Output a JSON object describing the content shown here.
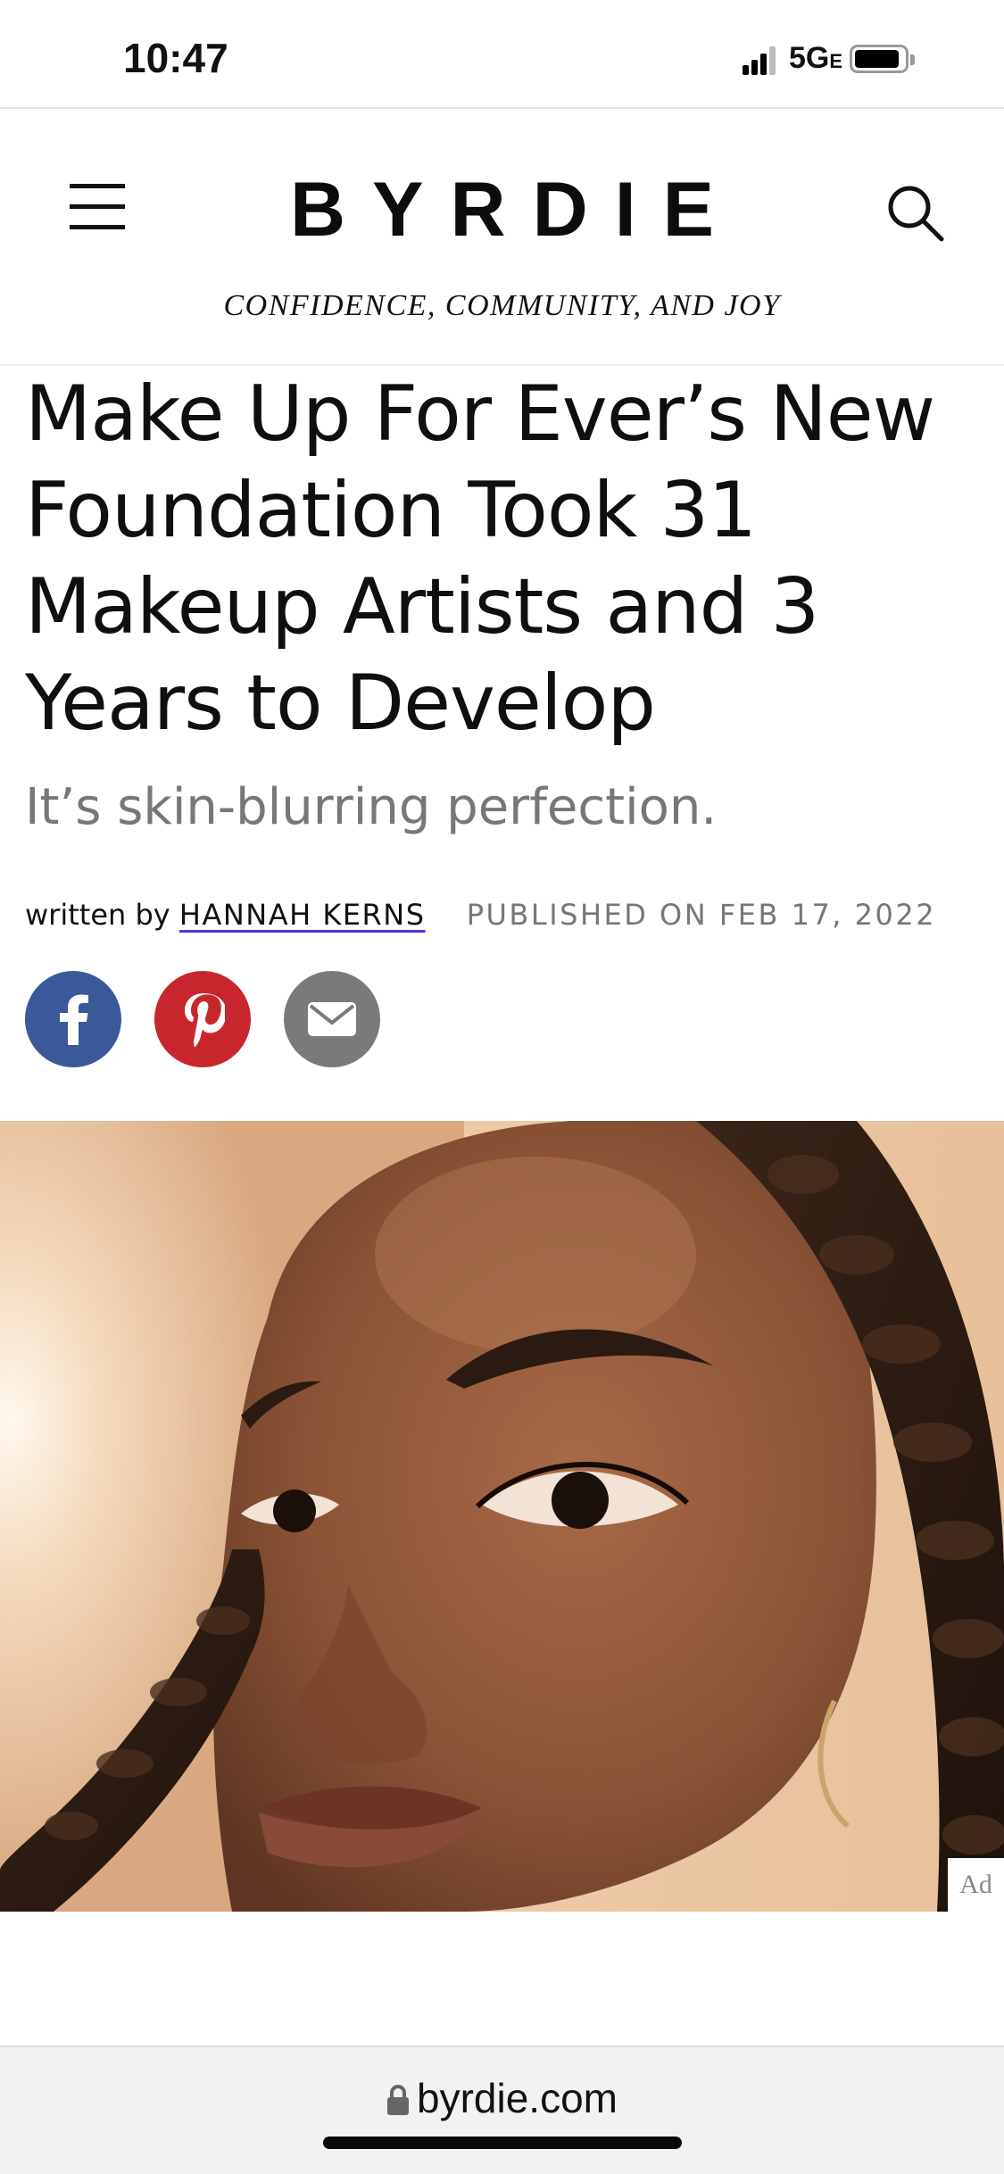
{
  "status_bar": {
    "time": "10:47",
    "network": "5G",
    "network_suffix": "E",
    "signal_bars": 3,
    "battery_level": 0.9
  },
  "header": {
    "logo": "BYRDIE",
    "tagline": "CONFIDENCE, COMMUNITY, AND JOY",
    "menu_icon": "hamburger-menu-icon",
    "search_icon": "search-icon"
  },
  "article": {
    "headline": "Make Up For Ever’s New Foundation Took 31 Makeup Artists and 3 Years to Develop",
    "subhead": "It’s skin-blurring perfection.",
    "byline_prefix": "written by",
    "author": "HANNAH KERNS",
    "published": "PUBLISHED ON FEB 17, 2022",
    "share_buttons": [
      {
        "name": "facebook",
        "icon": "facebook-icon",
        "color": "#3b5998"
      },
      {
        "name": "pinterest",
        "icon": "pinterest-icon",
        "color": "#c8262d"
      },
      {
        "name": "email",
        "icon": "email-icon",
        "color": "#7a7a7a"
      }
    ]
  },
  "ad": {
    "label": "Ad"
  },
  "browser": {
    "url": "byrdie.com",
    "lock_icon": "lock-icon"
  }
}
